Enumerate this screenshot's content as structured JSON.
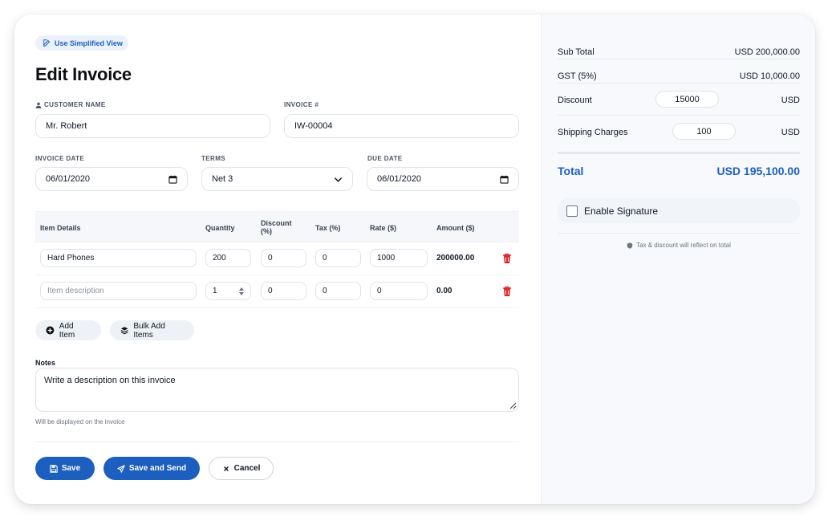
{
  "header": {
    "simplified_label": "Use Simplified View",
    "title": "Edit Invoice"
  },
  "form": {
    "customer_label": "CUSTOMER NAME",
    "customer_value": "Mr. Robert",
    "invoice_no_label": "INVOICE #",
    "invoice_no_value": "IW-00004",
    "invoice_date_label": "INVOICE DATE",
    "invoice_date_value": "06/01/2020",
    "terms_label": "TERMS",
    "terms_value": "Net 3",
    "due_date_label": "DUE DATE",
    "due_date_value": "06/01/2020"
  },
  "table": {
    "headers": {
      "item": "Item Details",
      "quantity": "Quantity",
      "discount_line1": "Discount",
      "discount_line2": "(%)",
      "tax": "Tax (%)",
      "rate": "Rate ($)",
      "amount": "Amount ($)"
    },
    "rows": [
      {
        "item": "Hard Phones",
        "quantity": "200",
        "discount": "0",
        "tax": "0",
        "rate": "1000",
        "amount": "200000.00"
      },
      {
        "item_placeholder": "Item description",
        "quantity": "1",
        "discount": "0",
        "tax": "0",
        "rate": "0",
        "amount": "0.00"
      }
    ]
  },
  "actions": {
    "add_item": "Add Item",
    "bulk_add": "Bulk Add Items"
  },
  "notes": {
    "label": "Notes",
    "value": "Write a description on this invoice",
    "hint": "Will be displayed on the invoice"
  },
  "buttons": {
    "save": "Save",
    "save_send": "Save and Send",
    "cancel": "Cancel"
  },
  "summary": {
    "subtotal_label": "Sub Total",
    "subtotal_value": "USD 200,000.00",
    "gst_label": "GST (5%)",
    "gst_value": "USD 10,000.00",
    "discount_label": "Discount",
    "discount_value": "15000",
    "discount_currency": "USD",
    "shipping_label": "Shipping Charges",
    "shipping_value": "100",
    "shipping_currency": "USD",
    "total_label": "Total",
    "total_value": "USD 195,100.00",
    "signature_label": "Enable Signature",
    "tax_note": "Tax & discount will reflect on total"
  },
  "colors": {
    "accent": "#1d5fbf",
    "danger": "#dc2626"
  }
}
